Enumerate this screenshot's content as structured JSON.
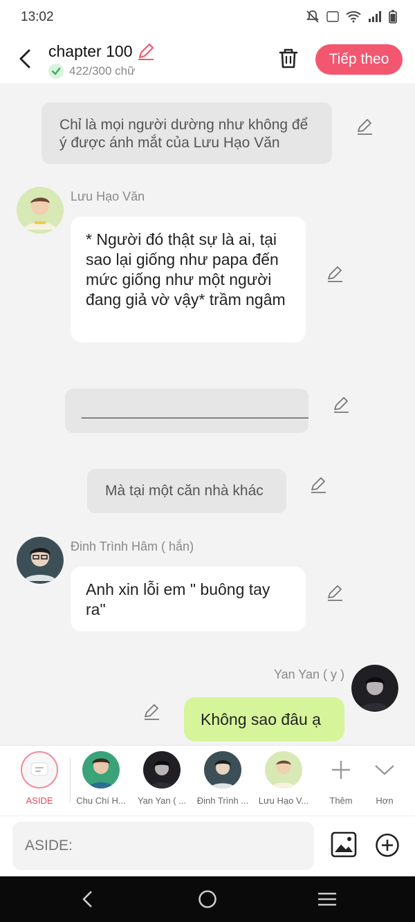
{
  "status": {
    "time": "13:02"
  },
  "header": {
    "title": "chapter 100",
    "word_count": "422/300 chữ",
    "next_label": "Tiếp theo"
  },
  "messages": {
    "n1": "Chỉ là mọi người dường như không để ý được ánh mắt của Lưu Hạo Văn",
    "m1_name": "Lưu Hạo Văn",
    "m1_text": "* Người đó thật sự là ai, tại sao lại giống như papa đến mức giống như một người đang giả vờ vậy* trầm ngâm",
    "n2": "______________________________",
    "n3": "Mà tại một căn nhà khác",
    "m2_name": "Đinh Trình Hâm ( hắn)",
    "m2_text": "Anh xin lỗi em \" buông tay ra\"",
    "m3_name": "Yan Yan ( y )",
    "m3_text": "Không sao đâu ạ"
  },
  "characters": [
    {
      "label": "ASIDE"
    },
    {
      "label": "Chu Chí H..."
    },
    {
      "label": "Yan Yan ( ..."
    },
    {
      "label": "Đinh Trình ..."
    },
    {
      "label": "Lưu Hạo V..."
    },
    {
      "label": "Thêm"
    },
    {
      "label": "Hơn"
    }
  ],
  "input": {
    "placeholder": "ASIDE:"
  },
  "colors": {
    "accent": "#f2576f",
    "green_bubble": "#d6f59a"
  }
}
